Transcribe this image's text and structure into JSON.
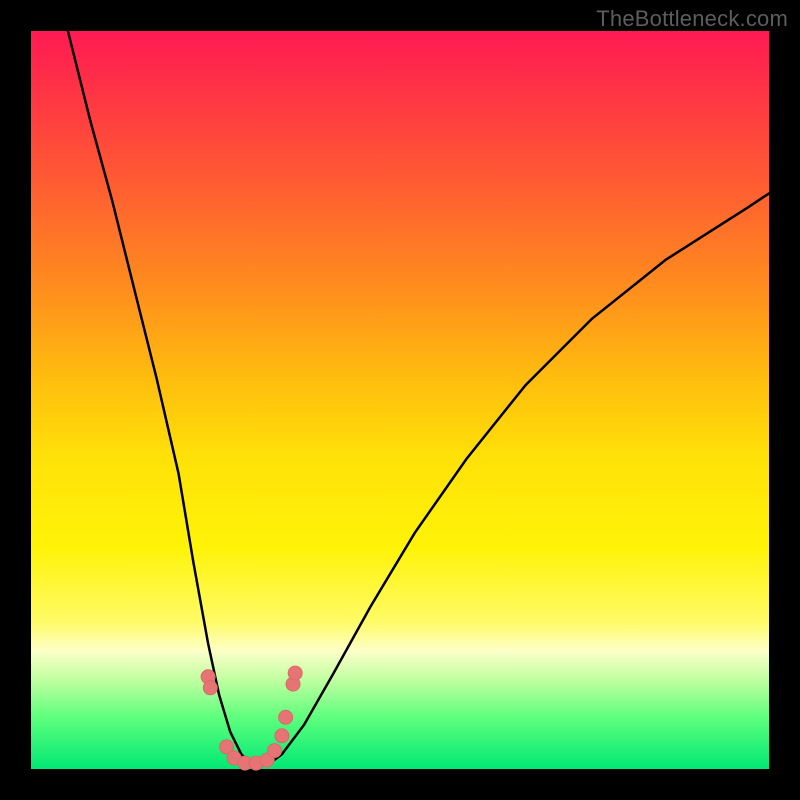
{
  "watermark": "TheBottleneck.com",
  "chart_data": {
    "type": "line",
    "title": "",
    "xlabel": "",
    "ylabel": "",
    "xlim": [
      0,
      100
    ],
    "ylim": [
      0,
      100
    ],
    "grid": false,
    "series": [
      {
        "name": "bottleneck-curve",
        "x": [
          5,
          8,
          11,
          14,
          17,
          20,
          22,
          24,
          25.5,
          27,
          28.5,
          30,
          32,
          34,
          37,
          41,
          46,
          52,
          59,
          67,
          76,
          86,
          97,
          100
        ],
        "y": [
          100,
          88,
          77,
          65,
          53,
          40,
          28,
          17,
          10,
          5,
          2,
          0.5,
          0.5,
          2,
          6,
          13,
          22,
          32,
          42,
          52,
          61,
          69,
          76,
          78
        ]
      }
    ],
    "marker_cluster": {
      "name": "highlight-points",
      "points": [
        {
          "x": 24.0,
          "y": 12.5
        },
        {
          "x": 24.3,
          "y": 11.0
        },
        {
          "x": 26.5,
          "y": 3.0
        },
        {
          "x": 27.5,
          "y": 1.5
        },
        {
          "x": 29.0,
          "y": 0.8
        },
        {
          "x": 30.5,
          "y": 0.8
        },
        {
          "x": 32.0,
          "y": 1.2
        },
        {
          "x": 33.0,
          "y": 2.5
        },
        {
          "x": 34.0,
          "y": 4.5
        },
        {
          "x": 34.5,
          "y": 7.0
        },
        {
          "x": 35.5,
          "y": 11.5
        },
        {
          "x": 35.8,
          "y": 13.0
        }
      ]
    },
    "background_gradient": {
      "top_color": "#ff1a53",
      "mid_color": "#fff308",
      "bottom_color": "#00e874"
    }
  }
}
